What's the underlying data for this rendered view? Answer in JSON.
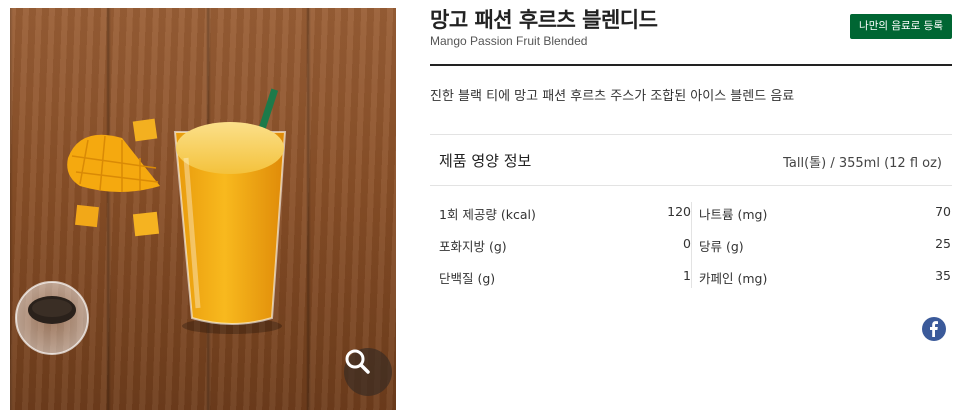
{
  "product": {
    "name_kr": "망고 패션 후르츠 블렌디드",
    "name_en": "Mango Passion Fruit Blended",
    "description": "진한 블랙 티에 망고 패션 후르츠 주스가 조합된 아이스 블렌드 음료",
    "favorite_button": "나만의 음료로 등록"
  },
  "nutrition": {
    "title": "제품 영양 정보",
    "serving": "Tall(톨) / 355ml (12 fl oz)",
    "left": [
      {
        "label": "1회 제공량 (kcal)",
        "value": "120"
      },
      {
        "label": "포화지방 (g)",
        "value": "0"
      },
      {
        "label": "단백질 (g)",
        "value": "1"
      }
    ],
    "right": [
      {
        "label": "나트륨 (mg)",
        "value": "70"
      },
      {
        "label": "당류 (g)",
        "value": "25"
      },
      {
        "label": "카페인 (mg)",
        "value": "35"
      }
    ]
  },
  "icons": {
    "zoom": "magnifier-icon",
    "share": "facebook-icon"
  },
  "colors": {
    "brand_green": "#006633",
    "facebook_blue": "#3b5a9a"
  }
}
